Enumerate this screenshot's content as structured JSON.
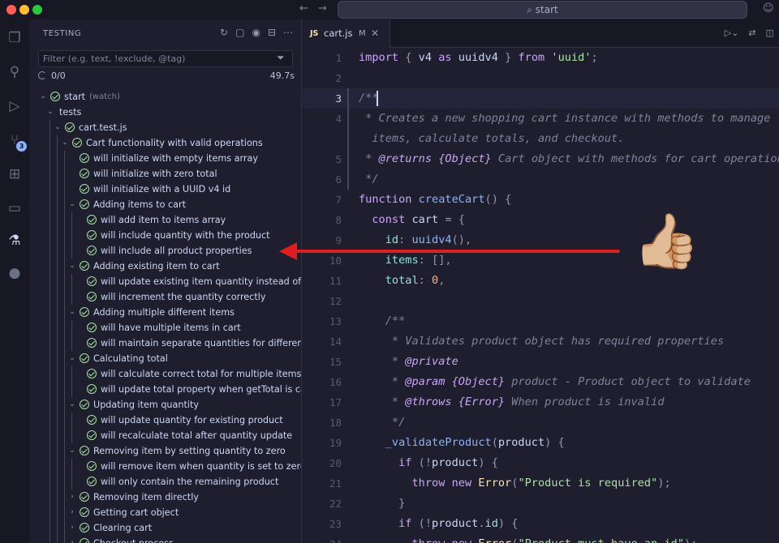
{
  "window": {
    "search_text": "start"
  },
  "activity_bar": {
    "scm_badge": "3"
  },
  "sidebar": {
    "title": "TESTING",
    "filter_placeholder": "Filter (e.g. text, !exclude, @tag)",
    "status": {
      "progress": "0/0",
      "duration": "49.7s"
    },
    "tree": [
      {
        "label": "start",
        "suffix": "(watch)",
        "depth": 0,
        "chevron": "down"
      },
      {
        "label": "tests",
        "depth": 1,
        "chevron": "down",
        "no_check": true
      },
      {
        "label": "cart.test.js",
        "depth": 2,
        "chevron": "down"
      },
      {
        "label": "Cart functionality with valid operations",
        "depth": 3,
        "chevron": "down"
      },
      {
        "label": "will initialize with empty items array",
        "depth": 4
      },
      {
        "label": "will initialize with zero total",
        "depth": 4
      },
      {
        "label": "will initialize with a UUID v4 id",
        "depth": 4
      },
      {
        "label": "Adding items to cart",
        "depth": 4,
        "chevron": "down"
      },
      {
        "label": "will add item to items array",
        "depth": 5
      },
      {
        "label": "will include quantity with the product",
        "depth": 5
      },
      {
        "label": "will include all product properties",
        "depth": 5
      },
      {
        "label": "Adding existing item to cart",
        "depth": 4,
        "chevron": "down"
      },
      {
        "label": "will update existing item quantity instead of ad...",
        "depth": 5
      },
      {
        "label": "will increment the quantity correctly",
        "depth": 5
      },
      {
        "label": "Adding multiple different items",
        "depth": 4,
        "chevron": "down"
      },
      {
        "label": "will have multiple items in cart",
        "depth": 5
      },
      {
        "label": "will maintain separate quantities for different pr...",
        "depth": 5
      },
      {
        "label": "Calculating total",
        "depth": 4,
        "chevron": "down"
      },
      {
        "label": "will calculate correct total for multiple items",
        "depth": 5
      },
      {
        "label": "will update total property when getTotal is called",
        "depth": 5
      },
      {
        "label": "Updating item quantity",
        "depth": 4,
        "chevron": "down"
      },
      {
        "label": "will update quantity for existing product",
        "depth": 5
      },
      {
        "label": "will recalculate total after quantity update",
        "depth": 5
      },
      {
        "label": "Removing item by setting quantity to zero",
        "depth": 4,
        "chevron": "down"
      },
      {
        "label": "will remove item when quantity is set to zero",
        "depth": 5
      },
      {
        "label": "will only contain the remaining product",
        "depth": 5
      },
      {
        "label": "Removing item directly",
        "depth": 4,
        "chevron": "right"
      },
      {
        "label": "Getting cart object",
        "depth": 4,
        "chevron": "right"
      },
      {
        "label": "Clearing cart",
        "depth": 4,
        "chevron": "right"
      },
      {
        "label": "Checkout process",
        "depth": 4,
        "chevron": "right"
      }
    ]
  },
  "editor": {
    "tab": {
      "icon": "JS",
      "name": "cart.js",
      "modified": "M"
    },
    "current_line": 3,
    "lines": [
      {
        "n": "1",
        "t": [
          [
            "kw",
            "import"
          ],
          [
            "pun",
            " { "
          ],
          [
            "var",
            "v4 "
          ],
          [
            "kw",
            "as"
          ],
          [
            "var",
            " uuidv4"
          ],
          [
            "pun",
            " } "
          ],
          [
            "kw",
            "from"
          ],
          [
            "str",
            " 'uuid'"
          ],
          [
            "pun",
            ";"
          ]
        ]
      },
      {
        "n": "2",
        "t": []
      },
      {
        "n": "3",
        "t": [
          [
            "cm",
            "/**"
          ]
        ],
        "cur": true,
        "gutter": true
      },
      {
        "n": "4",
        "t": [
          [
            "cm",
            " * Creates a new shopping cart instance with methods to manage"
          ]
        ],
        "gutter": true
      },
      {
        "n": "",
        "t": [
          [
            "cm",
            "  items, calculate totals, and checkout."
          ]
        ],
        "gutter": true
      },
      {
        "n": "5",
        "t": [
          [
            "cm",
            " * "
          ],
          [
            "cmt",
            "@returns"
          ],
          [
            "cm",
            " "
          ],
          [
            "cmt",
            "{Object}"
          ],
          [
            "cm",
            " Cart object with methods for cart operations"
          ]
        ],
        "gutter": true
      },
      {
        "n": "6",
        "t": [
          [
            "cm",
            " */"
          ]
        ],
        "gutter": true
      },
      {
        "n": "7",
        "t": [
          [
            "kw",
            "function"
          ],
          [
            "fn",
            " createCart"
          ],
          [
            "pun",
            "() {"
          ]
        ]
      },
      {
        "n": "8",
        "t": [
          [
            "kw",
            "  const"
          ],
          [
            "var",
            " cart "
          ],
          [
            "pun",
            "= {"
          ]
        ]
      },
      {
        "n": "9",
        "t": [
          [
            "prop",
            "    id"
          ],
          [
            "pun",
            ": "
          ],
          [
            "fn",
            "uuidv4"
          ],
          [
            "pun",
            "(),"
          ]
        ]
      },
      {
        "n": "10",
        "t": [
          [
            "prop",
            "    items"
          ],
          [
            "pun",
            ": [],"
          ]
        ]
      },
      {
        "n": "11",
        "t": [
          [
            "prop",
            "    total"
          ],
          [
            "pun",
            ": "
          ],
          [
            "num",
            "0"
          ],
          [
            "pun",
            ","
          ]
        ]
      },
      {
        "n": "12",
        "t": []
      },
      {
        "n": "13",
        "t": [
          [
            "cm",
            "    /**"
          ]
        ]
      },
      {
        "n": "14",
        "t": [
          [
            "cm",
            "     * Validates product object has required properties"
          ]
        ]
      },
      {
        "n": "15",
        "t": [
          [
            "cm",
            "     * "
          ],
          [
            "cmt",
            "@private"
          ]
        ]
      },
      {
        "n": "16",
        "t": [
          [
            "cm",
            "     * "
          ],
          [
            "cmt",
            "@param"
          ],
          [
            "cm",
            " "
          ],
          [
            "cmt",
            "{Object}"
          ],
          [
            "cm",
            " product - Product object to validate"
          ]
        ]
      },
      {
        "n": "17",
        "t": [
          [
            "cm",
            "     * "
          ],
          [
            "cmt",
            "@throws"
          ],
          [
            "cm",
            " "
          ],
          [
            "cmt",
            "{Error}"
          ],
          [
            "cm",
            " When product is invalid"
          ]
        ]
      },
      {
        "n": "18",
        "t": [
          [
            "cm",
            "     */"
          ]
        ]
      },
      {
        "n": "19",
        "t": [
          [
            "fn",
            "    _validateProduct"
          ],
          [
            "pun",
            "("
          ],
          [
            "var",
            "product"
          ],
          [
            "pun",
            ") {"
          ]
        ]
      },
      {
        "n": "20",
        "t": [
          [
            "kw",
            "      if"
          ],
          [
            "pun",
            " (!"
          ],
          [
            "var",
            "product"
          ],
          [
            "pun",
            ") {"
          ]
        ]
      },
      {
        "n": "21",
        "t": [
          [
            "kw",
            "        throw new"
          ],
          [
            "cls",
            " Error"
          ],
          [
            "pun",
            "("
          ],
          [
            "str",
            "\"Product is required\""
          ],
          [
            "pun",
            ");"
          ]
        ]
      },
      {
        "n": "22",
        "t": [
          [
            "pun",
            "      }"
          ]
        ]
      },
      {
        "n": "23",
        "t": [
          [
            "kw",
            "      if"
          ],
          [
            "pun",
            " (!"
          ],
          [
            "var",
            "product"
          ],
          [
            "pun",
            "."
          ],
          [
            "prop",
            "id"
          ],
          [
            "pun",
            ") {"
          ]
        ]
      },
      {
        "n": "24",
        "t": [
          [
            "kw",
            "        throw new"
          ],
          [
            "cls",
            " Error"
          ],
          [
            "pun",
            "("
          ],
          [
            "str",
            "\"Product must have an id\""
          ],
          [
            "pun",
            ");"
          ]
        ]
      }
    ]
  }
}
